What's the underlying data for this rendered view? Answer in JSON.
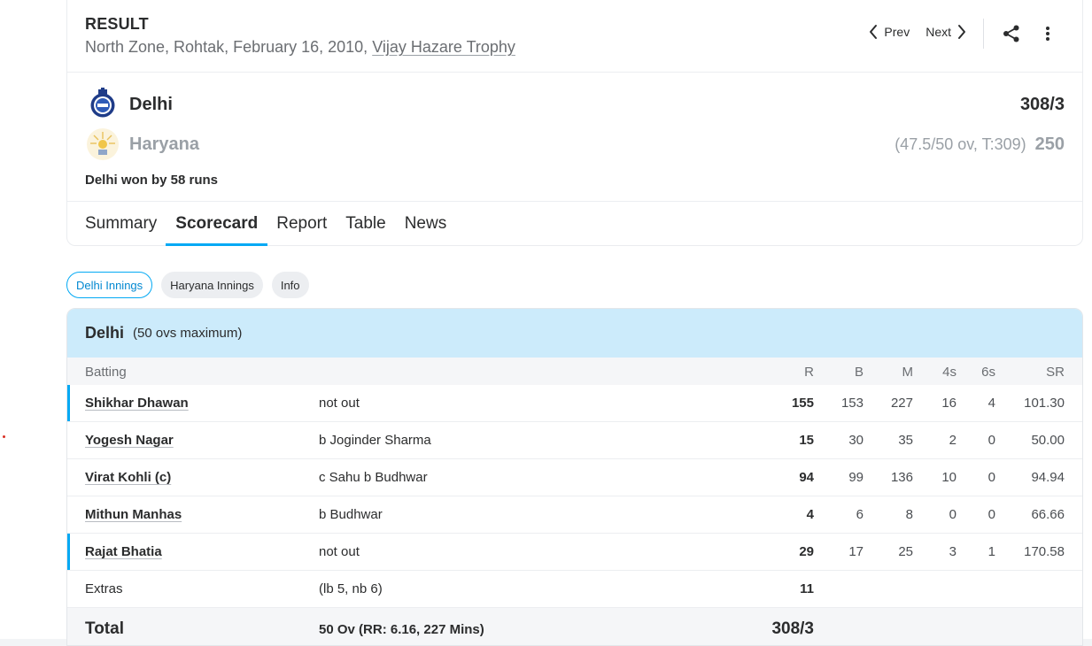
{
  "match": {
    "status": "RESULT",
    "info_prefix": "North Zone, Rohtak, February 16, 2010, ",
    "series_link": "Vijay Hazare Trophy",
    "nav": {
      "prev": "Prev",
      "next": "Next"
    },
    "teams": [
      {
        "name": "Delhi",
        "overs": "",
        "score": "308/3"
      },
      {
        "name": "Haryana",
        "overs": "(47.5/50 ov, T:309)",
        "score": "250"
      }
    ],
    "result": "Delhi won by 58 runs",
    "tabs": [
      "Summary",
      "Scorecard",
      "Report",
      "Table",
      "News"
    ],
    "active_tab": "Scorecard"
  },
  "innings_pills": [
    "Delhi Innings",
    "Haryana Innings",
    "Info"
  ],
  "innings": {
    "team": "Delhi",
    "max": "(50 ovs maximum)",
    "headers": {
      "batting": "Batting",
      "r": "R",
      "b": "B",
      "m": "M",
      "fours": "4s",
      "sixes": "6s",
      "sr": "SR"
    },
    "batters": [
      {
        "name": "Shikhar Dhawan",
        "dismissal": "not out",
        "r": "155",
        "b": "153",
        "m": "227",
        "fours": "16",
        "sixes": "4",
        "sr": "101.30"
      },
      {
        "name": "Yogesh Nagar",
        "dismissal": "b Joginder Sharma",
        "r": "15",
        "b": "30",
        "m": "35",
        "fours": "2",
        "sixes": "0",
        "sr": "50.00"
      },
      {
        "name": "Virat Kohli (c)",
        "dismissal": "c Sahu b Budhwar",
        "r": "94",
        "b": "99",
        "m": "136",
        "fours": "10",
        "sixes": "0",
        "sr": "94.94"
      },
      {
        "name": "Mithun Manhas",
        "dismissal": "b Budhwar",
        "r": "4",
        "b": "6",
        "m": "8",
        "fours": "0",
        "sixes": "0",
        "sr": "66.66"
      },
      {
        "name": "Rajat Bhatia",
        "dismissal": "not out",
        "r": "29",
        "b": "17",
        "m": "25",
        "fours": "3",
        "sixes": "1",
        "sr": "170.58"
      }
    ],
    "extras": {
      "label": "Extras",
      "detail": "(lb 5, nb 6)",
      "value": "11"
    },
    "total": {
      "label": "Total",
      "detail": "50 Ov (RR: 6.16, 227 Mins)",
      "value": "308/3"
    }
  },
  "colors": {
    "accent": "#03a9f4",
    "innings_header_bg": "#ccebfb"
  }
}
